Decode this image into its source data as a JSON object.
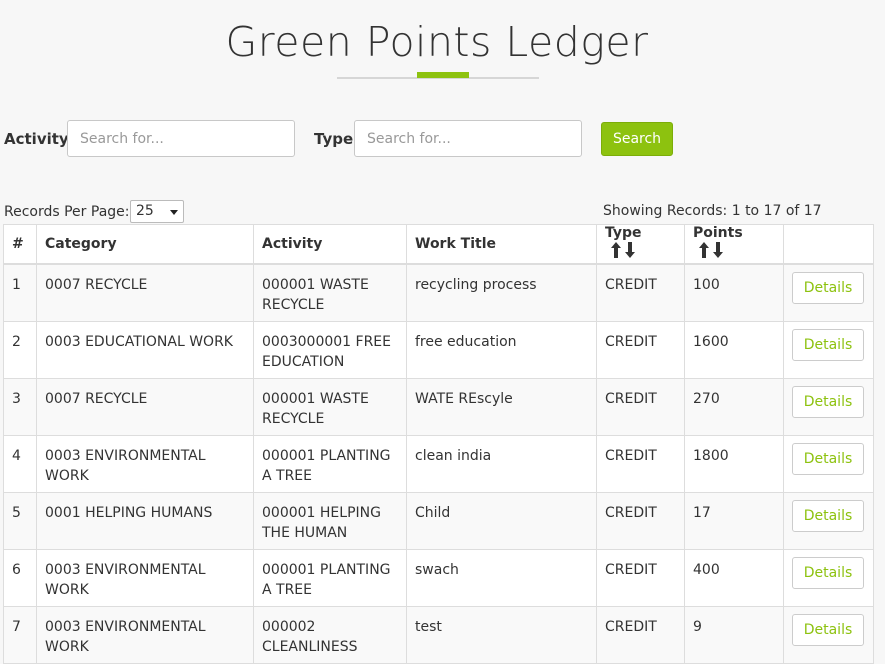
{
  "header": {
    "title": "Green Points Ledger"
  },
  "filters": {
    "activity_label": "Activity",
    "activity_placeholder": "Search for...",
    "type_label": "Type",
    "type_placeholder": "Search for...",
    "search_label": "Search"
  },
  "pagination": {
    "records_per_page_label": "Records Per Page:",
    "records_per_page_value": "25",
    "showing_text": "Showing Records: 1 to 17 of 17"
  },
  "table": {
    "columns": [
      "#",
      "Category",
      "Activity",
      "Work Title",
      "Type",
      "Points",
      ""
    ],
    "details_label": "Details",
    "rows": [
      {
        "num": "1",
        "category": "0007 RECYCLE",
        "activity": "000001 WASTE RECYCLE",
        "work_title": "recycling process",
        "type": "CREDIT",
        "points": "100"
      },
      {
        "num": "2",
        "category": "0003 EDUCATIONAL WORK",
        "activity": "0003000001 FREE EDUCATION",
        "work_title": "free education",
        "type": "CREDIT",
        "points": "1600"
      },
      {
        "num": "3",
        "category": "0007 RECYCLE",
        "activity": "000001 WASTE RECYCLE",
        "work_title": "WATE REscyle",
        "type": "CREDIT",
        "points": "270"
      },
      {
        "num": "4",
        "category": "0003 ENVIRONMENTAL WORK",
        "activity": "000001 PLANTING A TREE",
        "work_title": "clean india",
        "type": "CREDIT",
        "points": "1800"
      },
      {
        "num": "5",
        "category": "0001 HELPING HUMANS",
        "activity": "000001 HELPING THE HUMAN",
        "work_title": "Child",
        "type": "CREDIT",
        "points": "17"
      },
      {
        "num": "6",
        "category": "0003 ENVIRONMENTAL WORK",
        "activity": "000001 PLANTING A TREE",
        "work_title": "swach",
        "type": "CREDIT",
        "points": "400"
      },
      {
        "num": "7",
        "category": "0003 ENVIRONMENTAL WORK",
        "activity": "000002 CLEANLINESS",
        "work_title": "test",
        "type": "CREDIT",
        "points": "9"
      }
    ]
  },
  "colors": {
    "accent": "#8dc20f",
    "border": "#dddddd",
    "background": "#f7f7f7"
  },
  "icons": {
    "sort": "sort-up-down-arrows-icon"
  }
}
